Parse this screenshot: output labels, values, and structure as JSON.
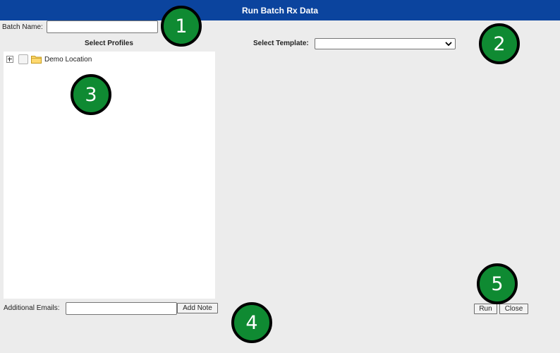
{
  "window": {
    "title": "Run Batch Rx Data"
  },
  "form": {
    "batch_name_label": "Batch Name:",
    "batch_name_value": "",
    "select_profiles_label": "Select Profiles",
    "select_template_label": "Select Template:",
    "template_selected": "",
    "additional_emails_label": "Additional Emails:",
    "additional_emails_value": ""
  },
  "tree": {
    "items": [
      {
        "label": "Demo Location",
        "icon": "folder-icon",
        "expanded": false,
        "checked": false
      }
    ]
  },
  "buttons": {
    "add_note": "Add Note",
    "run": "Run",
    "close": "Close"
  },
  "callouts": [
    "1",
    "2",
    "3",
    "4",
    "5"
  ],
  "colors": {
    "titlebar": "#0b449e",
    "background": "#ececec",
    "callout_fill": "#0f8a32",
    "callout_border": "#000000"
  }
}
